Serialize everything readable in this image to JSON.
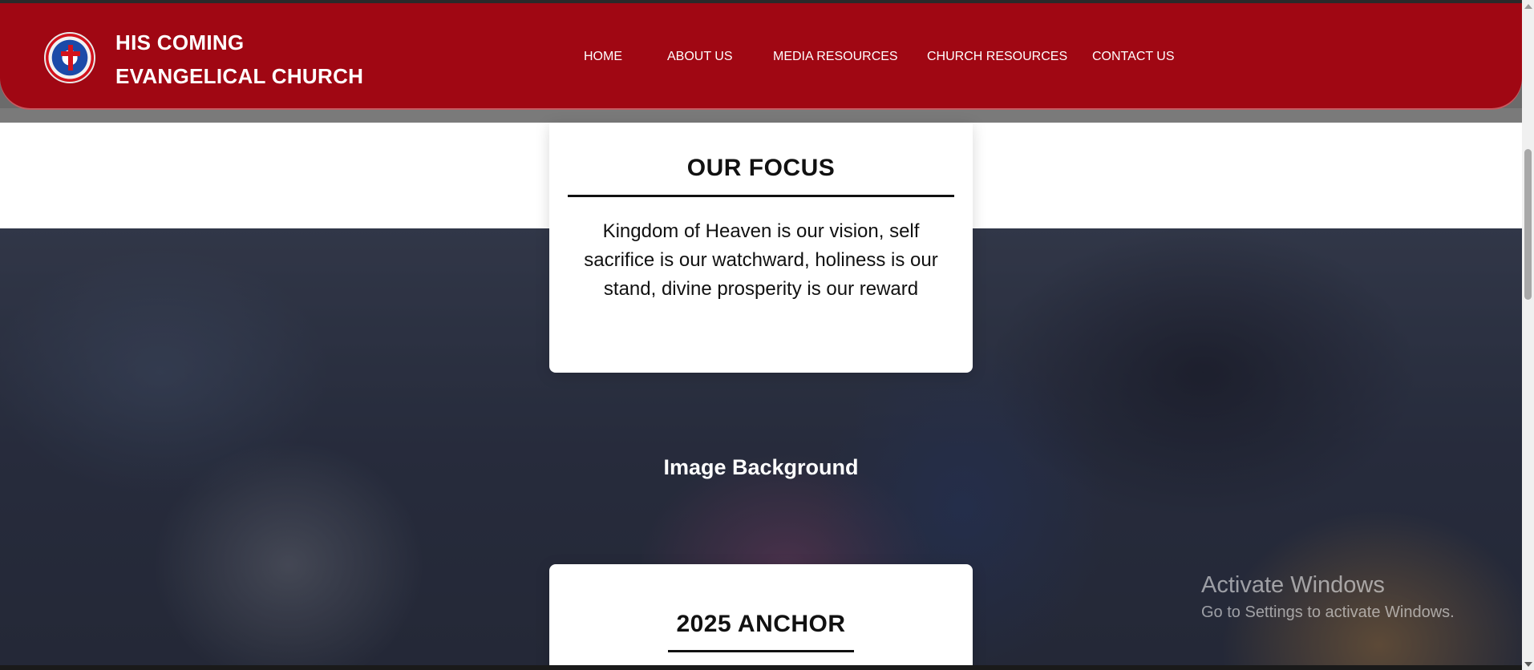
{
  "header": {
    "brand_line1": "HIS COMING",
    "brand_line2": "EVANGELICAL CHURCH",
    "logo_icon": "church-logo-icon",
    "background_color": "#a00713"
  },
  "nav": {
    "items": [
      {
        "label": "HOME"
      },
      {
        "label": "ABOUT US"
      },
      {
        "label": "MEDIA RESOURCES"
      },
      {
        "label": "CHURCH RESOURCES"
      },
      {
        "label": "CONTACT US"
      }
    ]
  },
  "focus_card": {
    "title": "OUR FOCUS",
    "text": "Kingdom of Heaven is our vision, self sacrifice is our watchward, holiness is our stand, divine prosperity is our reward"
  },
  "image_section": {
    "caption": "Image Background"
  },
  "anchor_card": {
    "title": "2025 ANCHOR"
  },
  "watermark": {
    "line1": "Activate Windows",
    "line2": "Go to Settings to activate Windows."
  }
}
